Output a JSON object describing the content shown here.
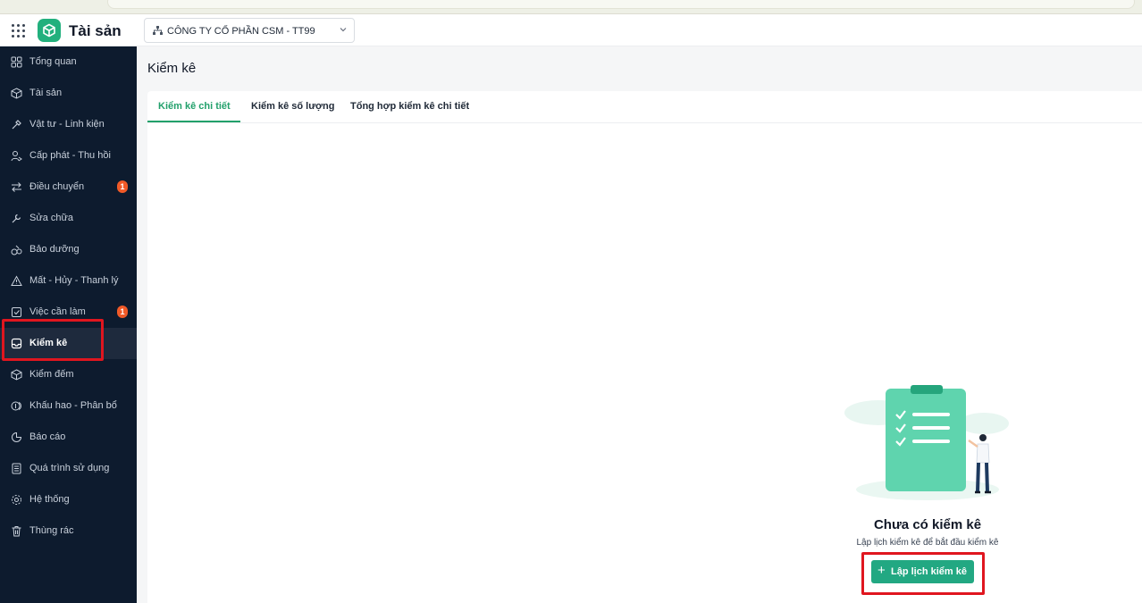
{
  "header": {
    "app_title": "Tài sản",
    "company": "CÔNG TY CỔ PHẦN CSM - TT99"
  },
  "sidebar": {
    "items": [
      {
        "label": "Tổng quan",
        "icon": "dashboard-icon"
      },
      {
        "label": "Tài sản",
        "icon": "cube-icon"
      },
      {
        "label": "Vật tư - Linh kiện",
        "icon": "tool-icon"
      },
      {
        "label": "Cấp phát - Thu hồi",
        "icon": "user-transfer-icon"
      },
      {
        "label": "Điều chuyển",
        "icon": "swap-icon",
        "badge": "1"
      },
      {
        "label": "Sửa chữa",
        "icon": "wrench-icon"
      },
      {
        "label": "Bảo dưỡng",
        "icon": "maintenance-icon"
      },
      {
        "label": "Mất - Hủy - Thanh lý",
        "icon": "warning-icon"
      },
      {
        "label": "Việc cần làm",
        "icon": "checkbox-icon",
        "badge": "1"
      },
      {
        "label": "Kiểm kê",
        "icon": "inbox-icon",
        "active": true
      },
      {
        "label": "Kiểm đếm",
        "icon": "box-icon"
      },
      {
        "label": "Khấu hao - Phân bổ",
        "icon": "currency-icon"
      },
      {
        "label": "Báo cáo",
        "icon": "pie-chart-icon"
      },
      {
        "label": "Quá trình sử dụng",
        "icon": "document-icon"
      },
      {
        "label": "Hệ thống",
        "icon": "gear-icon"
      },
      {
        "label": "Thùng rác",
        "icon": "trash-icon"
      }
    ]
  },
  "main": {
    "page_title": "Kiểm kê",
    "tabs": [
      {
        "label": "Kiểm kê chi tiết",
        "active": true
      },
      {
        "label": "Kiểm kê số lượng"
      },
      {
        "label": "Tổng hợp kiểm kê chi tiết"
      }
    ],
    "empty": {
      "title": "Chưa có kiểm kê",
      "subtitle": "Lập lịch kiểm kê để bắt đầu kiểm kê",
      "button_label": "Lập lịch kiểm kê"
    }
  },
  "colors": {
    "sidebar_bg": "#0d1b2e",
    "accent": "#22a06b",
    "badge": "#f05a28",
    "highlight": "#e0161f"
  }
}
